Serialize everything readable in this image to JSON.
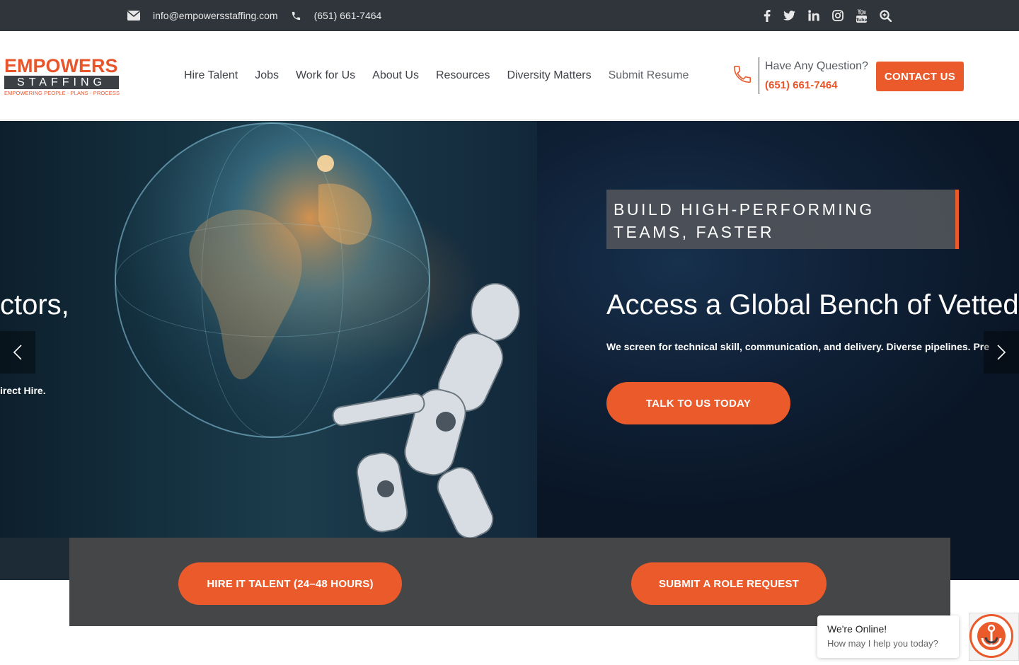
{
  "topbar": {
    "email": "info@empowersstaffing.com",
    "phone": "(651) 661-7464",
    "icons": [
      "envelope-icon",
      "phone-icon",
      "facebook-icon",
      "twitter-icon",
      "linkedin-icon",
      "instagram-icon",
      "youtube-icon",
      "search-zoom-icon"
    ]
  },
  "logo": {
    "line1": "EMPOWERS",
    "line2": "STAFFING",
    "tagline": "EMPOWERING PEOPLE - PLANS - PROCESS"
  },
  "nav": {
    "items": [
      "Hire Talent",
      "Jobs",
      "Work for Us",
      "About Us",
      "Resources",
      "Diversity Matters",
      "Submit Resume"
    ]
  },
  "header_contact": {
    "question": "Have Any Question?",
    "phone": "(651) 661-7464",
    "button": "CONTACT US"
  },
  "hero": {
    "prev_slide_headline": "ctors,",
    "prev_slide_sub": "irect Hire.",
    "tagline": "BUILD HIGH-PERFORMING TEAMS, FASTER",
    "headline": "Access a Global Bench of Vetted",
    "subline": "We screen for technical skill, communication, and delivery. Diverse pipelines. Pre",
    "cta": "TALK TO US TODAY"
  },
  "band": {
    "button_1": "HIRE IT TALENT (24–48 HOURS)",
    "button_2": "SUBMIT A ROLE REQUEST"
  },
  "chat": {
    "title": "We're Online!",
    "subtitle": "How may I help you today?"
  },
  "colors": {
    "accent": "#ea5a2b",
    "topbar": "#2f353b",
    "band": "#454648"
  }
}
